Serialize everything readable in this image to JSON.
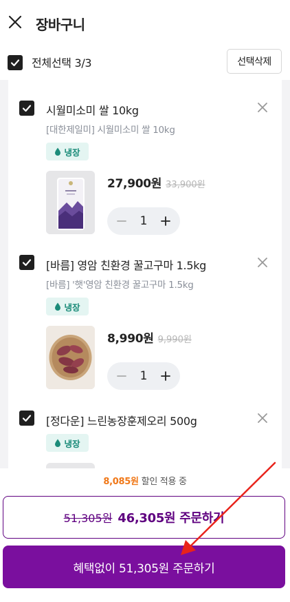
{
  "header": {
    "title": "장바구니",
    "close_icon": "close-icon"
  },
  "select_bar": {
    "label": "전체선택 3/3",
    "delete_label": "선택삭제"
  },
  "items": [
    {
      "name": "시월미소미 쌀 10kg",
      "sub": "[대한제일미] 시월미소미 쌀 10kg",
      "badge": "냉장",
      "price": "27,900원",
      "old_price": "33,900원",
      "qty": "1",
      "checked": true
    },
    {
      "name": "[바름] 영암 친환경 꿀고구마 1.5kg",
      "sub": "[바름]  '햇'영암 친환경 꿀고구마 1.5kg",
      "badge": "냉장",
      "price": "8,990원",
      "old_price": "9,990원",
      "qty": "1",
      "checked": true
    },
    {
      "name": "[정다운] 느린농장훈제오리 500g",
      "badge": "냉장",
      "checked": true
    }
  ],
  "footer": {
    "discount_amount": "8,085원",
    "discount_text": "할인 적용 중",
    "benefit_old": "51,305원",
    "benefit_main": "46,305원 주문하기",
    "nobenefit_label": "혜택없이 51,305원 주문하기"
  },
  "colors": {
    "accent_purple": "#5f0080",
    "button_purple": "#7a0f9e",
    "discount_orange": "#f07818",
    "badge_teal": "#1c8c7a",
    "annotation_red": "#e8231b"
  }
}
